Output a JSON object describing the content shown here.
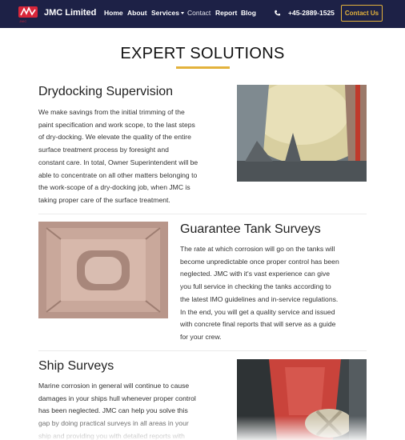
{
  "navbar": {
    "logo_label": "JMC",
    "brand": "JMC Limited",
    "links": [
      "Home",
      "About",
      "Services",
      "Contact",
      "Report",
      "Blog"
    ],
    "phone": "+45-2889-1525",
    "cta": "Contact Us"
  },
  "page": {
    "title": "EXPERT SOLUTIONS"
  },
  "sections": [
    {
      "title": "Drydocking Supervision",
      "lines": [
        "We make savings from the initial trimming of the",
        "paint specification and work scope, to the last steps",
        "of dry-docking. We elevate the quality of the entire",
        "surface treatment process by foresight and",
        "constant care. In total, Owner Superintendent will be",
        "able to concentrate on all other matters belonging to",
        "the work-scope of a dry-docking job, when JMC is",
        "taking proper care of the surface treatment."
      ]
    },
    {
      "title": "Guarantee Tank Surveys",
      "lines": [
        "The rate at which corrosion will go on the tanks will",
        "become unpredictable once proper control has been",
        "neglected. JMC with it's vast experience can give",
        "you full service in checking the tanks according to",
        "the latest IMO guidelines and in-service regulations.",
        "In the end, you will get a quality service and issued",
        "with concrete final reports that will serve as a guide",
        "for your crew."
      ]
    },
    {
      "title": "Ship Surveys",
      "lines": [
        "Marine corrosion in general will continue to cause",
        "damages in your ships hull whenever proper control",
        "has been neglected. JMC can help you solve this",
        "gap by doing practical surveys in all areas in your",
        "ship and providing you with detailed reports with"
      ]
    }
  ],
  "colors": {
    "navbar_bg": "#1d2146",
    "accent": "#e3b23c",
    "logo_red": "#d8263a"
  }
}
